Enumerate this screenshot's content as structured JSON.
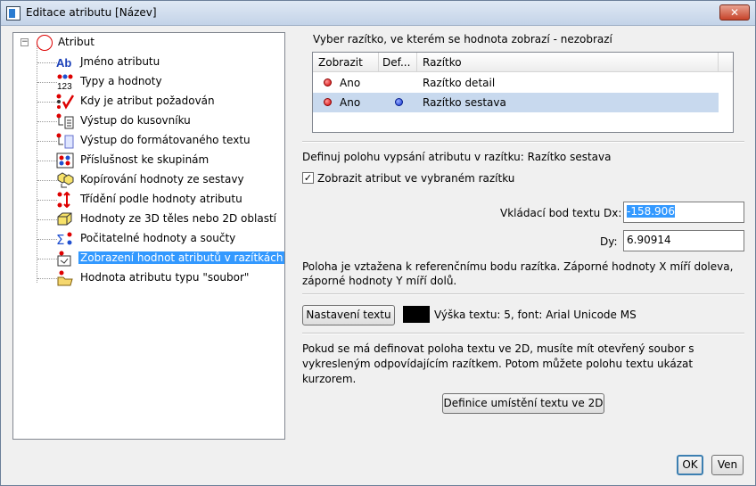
{
  "window": {
    "title": "Editace atributu [Název]",
    "close_label": "✕"
  },
  "tree": {
    "root_label": "Atribut",
    "items": [
      {
        "label": "Jméno atributu",
        "icon": "ab-icon"
      },
      {
        "label": "Typy a hodnoty",
        "icon": "types-icon"
      },
      {
        "label": "Kdy je atribut požadován",
        "icon": "required-icon"
      },
      {
        "label": "Výstup do kusovníku",
        "icon": "bom-output-icon"
      },
      {
        "label": "Výstup do formátovaného textu",
        "icon": "formatted-text-icon"
      },
      {
        "label": "Příslušnost ke skupinám",
        "icon": "groups-icon"
      },
      {
        "label": "Kopírování hodnoty ze sestavy",
        "icon": "copy-value-icon"
      },
      {
        "label": "Třídění podle hodnoty atributu",
        "icon": "sort-icon"
      },
      {
        "label": "Hodnoty ze 3D těles nebo 2D oblastí",
        "icon": "solid-icon"
      },
      {
        "label": "Počitatelné hodnoty a součty",
        "icon": "sum-icon"
      },
      {
        "label": "Zobrazení hodnot atributů v razítkách",
        "icon": "stamp-icon"
      },
      {
        "label": "Hodnota atributu typu \"soubor\"",
        "icon": "folder-icon"
      }
    ]
  },
  "stamps": {
    "heading": "Vyber razítko, ve kterém se hodnota zobrazí - nezobrazí",
    "columns": [
      "Zobrazit",
      "Def...",
      "Razítko"
    ],
    "rows": [
      {
        "show": "Ano",
        "default": "",
        "name": "Razítko detail"
      },
      {
        "show": "Ano",
        "default": "•",
        "name": "Razítko sestava"
      }
    ]
  },
  "position": {
    "heading": "Definuj polohu vypsání atributu v razítku: Razítko sestava",
    "checkbox_label": "Zobrazit atribut ve vybraném razítku",
    "checkbox_mark": "✓",
    "dx_label": "Vkládací bod textu Dx:",
    "dx_value": "-158.906",
    "dy_label": "Dy:",
    "dy_value": "6.90914",
    "note_line1": "Poloha je vztažena k referenčnímu bodu razítka. Záporné hodnoty X míří doleva,",
    "note_line2": "záporné hodnoty Y míří dolů."
  },
  "text_settings": {
    "button_label": "Nastavení textu",
    "info": "Výška textu: 5, font: Arial Unicode MS",
    "swatch_color": "#000000"
  },
  "define2d": {
    "line1": "Pokud se má definovat poloha textu ve 2D, musíte mít otevřený soubor s",
    "line2": "vykresleným odpovídajícím razítkem. Potom můžete polohu textu ukázat",
    "line3": "kurzorem.",
    "button_label": "Definice umístění textu ve 2D"
  },
  "footer": {
    "ok_label": "OK",
    "cancel_label": "Ven"
  }
}
